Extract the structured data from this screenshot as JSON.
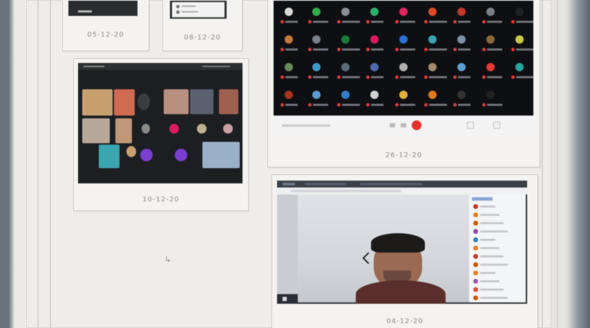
{
  "scene": "photo of a bulletboard with printed video-meeting screenshots",
  "cards": [
    {
      "id": "card-top-left",
      "date": "05-12-20"
    },
    {
      "id": "card-top-middle",
      "date": "08-12-20"
    },
    {
      "id": "card-grid",
      "date": "26-12-20"
    },
    {
      "id": "card-zoom",
      "date": "10-12-20"
    },
    {
      "id": "card-speaker",
      "date": "04-12-20"
    }
  ]
}
